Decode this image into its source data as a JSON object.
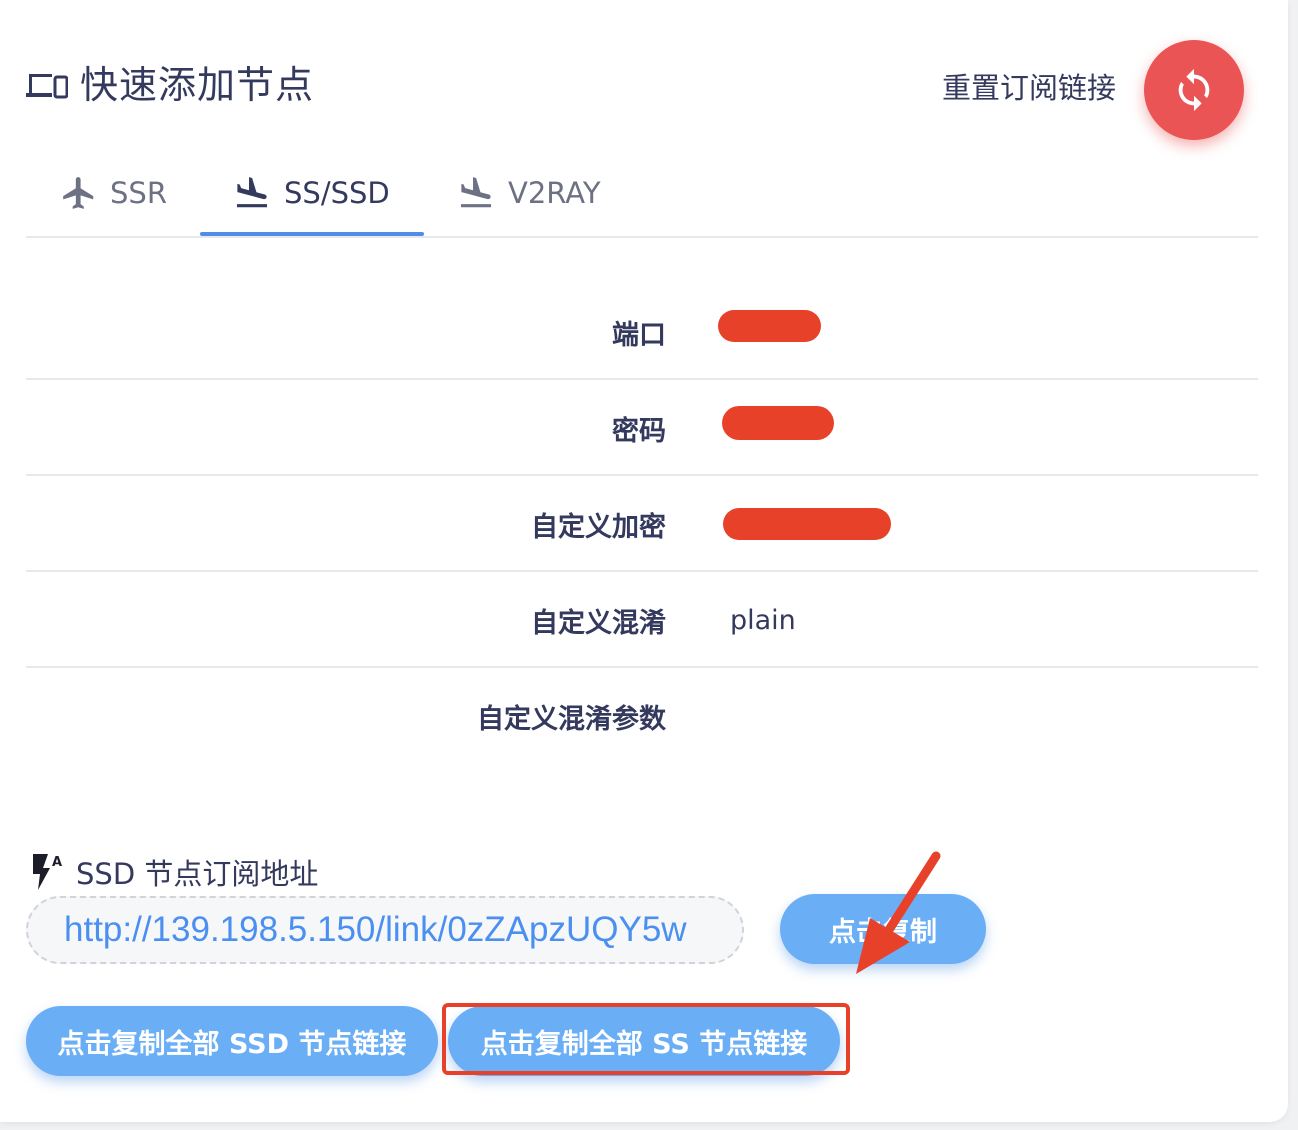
{
  "header": {
    "title": "快速添加节点",
    "icon": "devices-icon",
    "reset_label": "重置订阅链接",
    "reset_icon": "refresh-icon",
    "reset_color": "#ea5455"
  },
  "tabs": [
    {
      "label": "SSR",
      "icon": "airplane-icon",
      "active": false
    },
    {
      "label": "SS/SSD",
      "icon": "flight-land-icon",
      "active": true
    },
    {
      "label": "V2RAY",
      "icon": "flight-land-icon",
      "active": false
    }
  ],
  "fields": [
    {
      "label": "端口",
      "value": ""
    },
    {
      "label": "密码",
      "value": ""
    },
    {
      "label": "自定义加密",
      "value": ""
    },
    {
      "label": "自定义混淆",
      "value": "plain"
    },
    {
      "label": "自定义混淆参数",
      "value": ""
    }
  ],
  "ssd": {
    "title": "SSD 节点订阅地址",
    "url": "http://139.198.5.150/link/0zZApzUQY5w",
    "copy_label": "点击复制"
  },
  "buttons": {
    "copy_all_ssd": "点击复制全部 SSD 节点链接",
    "copy_all_ss": "点击复制全部 SS 节点链接"
  },
  "colors": {
    "accent": "#4f8ee6",
    "button": "#6aaef5",
    "annotation": "#e8412a"
  }
}
